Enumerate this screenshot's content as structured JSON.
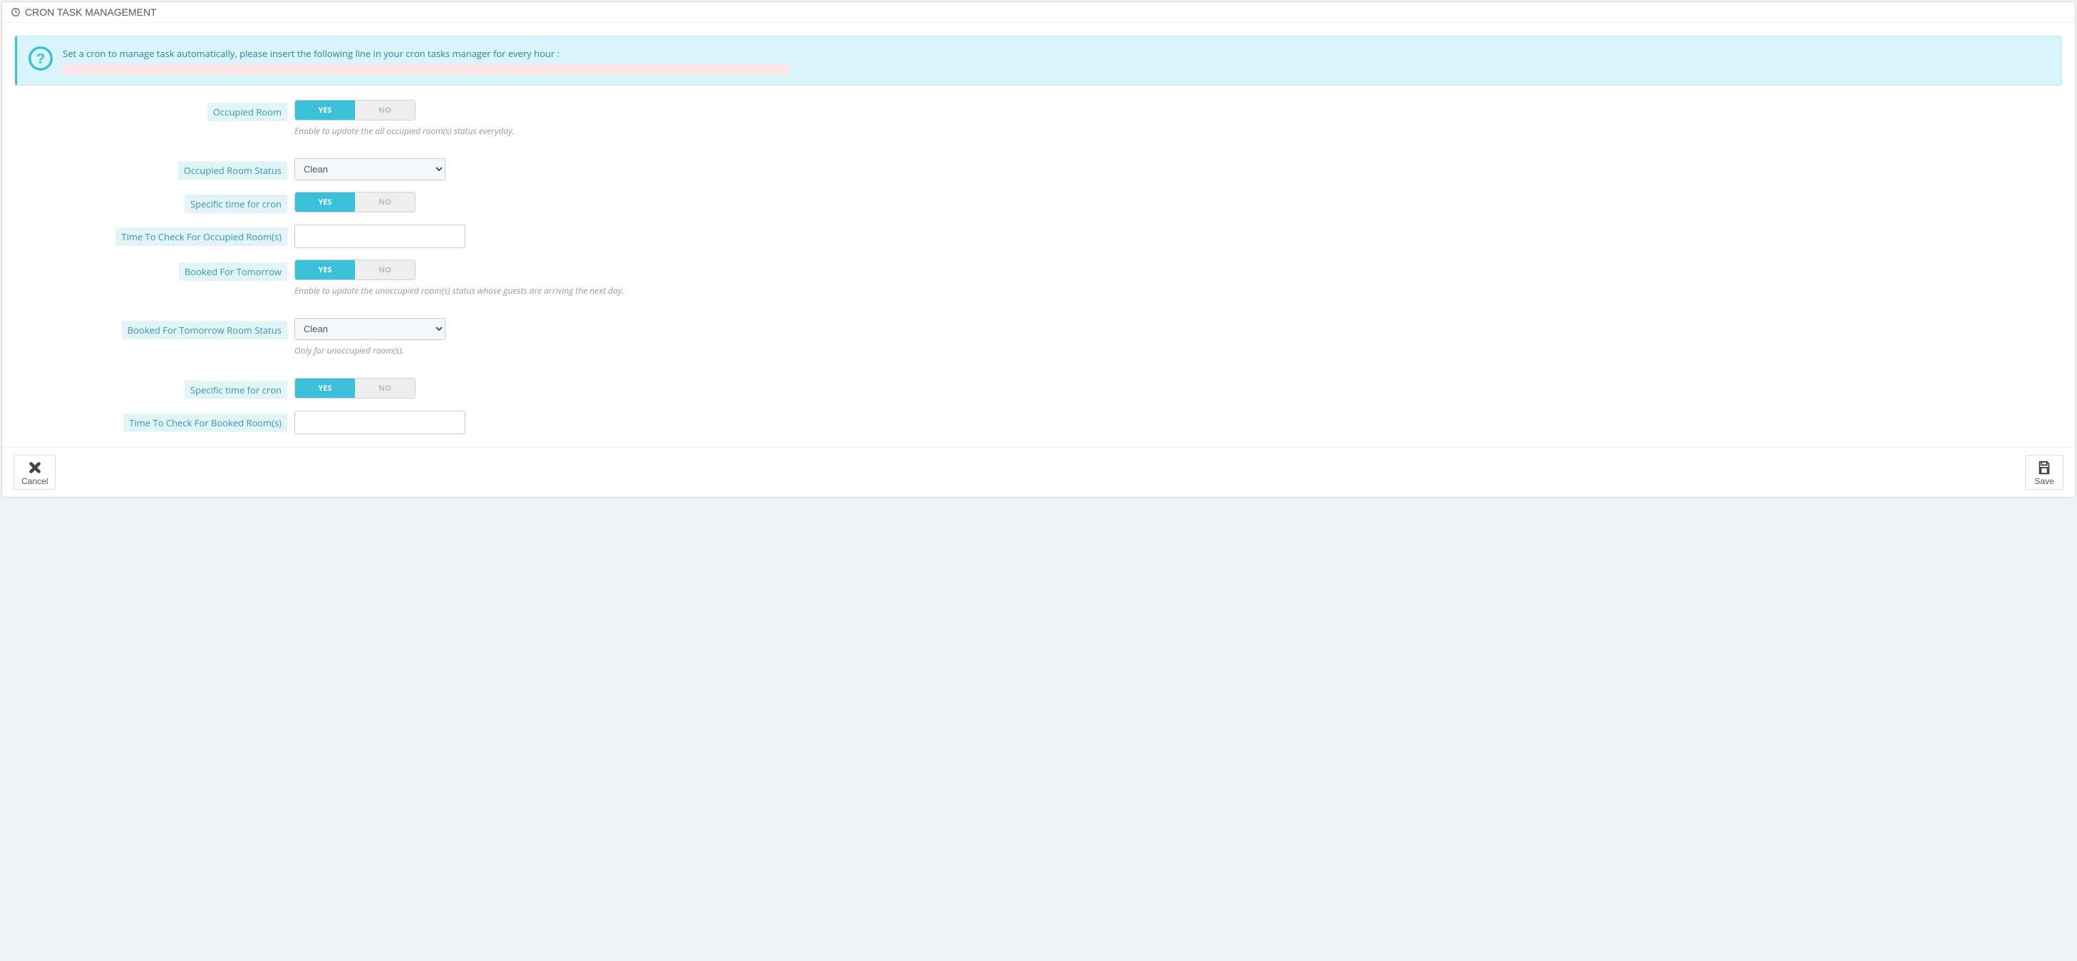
{
  "panel": {
    "title": "CRON TASK MANAGEMENT"
  },
  "alert": {
    "text": "Set a cron to manage task automatically, please insert the following line in your cron tasks manager for every hour :"
  },
  "toggleLabels": {
    "yes": "YES",
    "no": "NO"
  },
  "fields": {
    "occupied_room": {
      "label": "Occupied Room",
      "help": "Enable to update the all occupied room(s) status everyday."
    },
    "occupied_room_status": {
      "label": "Occupied Room Status",
      "value": "Clean"
    },
    "specific_time_1": {
      "label": "Specific time for cron"
    },
    "time_occupied": {
      "label": "Time To Check For Occupied Room(s)",
      "value": ""
    },
    "booked_tomorrow": {
      "label": "Booked For Tomorrow",
      "help": "Enable to update the unoccupied room(s) status whose guests are arriving the next day."
    },
    "booked_tomorrow_status": {
      "label": "Booked For Tomorrow Room Status",
      "value": "Clean",
      "help": "Only for unoccupied room(s)."
    },
    "specific_time_2": {
      "label": "Specific time for cron"
    },
    "time_booked": {
      "label": "Time To Check For Booked Room(s)",
      "value": ""
    }
  },
  "footer": {
    "cancel": "Cancel",
    "save": "Save"
  }
}
